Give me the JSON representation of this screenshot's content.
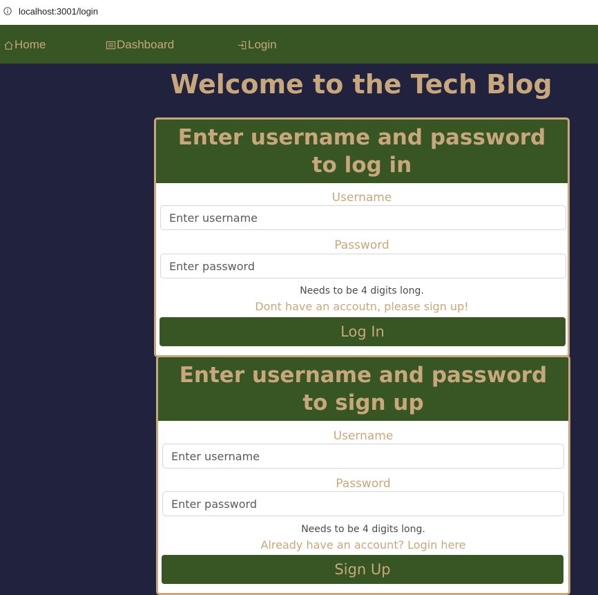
{
  "browser": {
    "url": "localhost:3001/login"
  },
  "nav": {
    "home": "Home",
    "dashboard": "Dashboard",
    "login": "Login"
  },
  "page": {
    "title": "Welcome to the Tech Blog"
  },
  "login_form": {
    "heading": "Enter username and password to log in",
    "username_label": "Username",
    "username_placeholder": "Enter username",
    "password_label": "Password",
    "password_placeholder": "Enter password",
    "hint": "Needs to be 4 digits long.",
    "switch_link": "Dont have an accoutn, please sign up!",
    "submit": "Log In"
  },
  "signup_form": {
    "heading": "Enter username and password to sign up",
    "username_label": "Username",
    "username_placeholder": "Enter username",
    "password_label": "Password",
    "password_placeholder": "Enter password",
    "hint": "Needs to be 4 digits long.",
    "switch_link": "Already have an account? Login here",
    "submit": "Sign Up"
  },
  "colors": {
    "background": "#21223d",
    "primary_green": "#375623",
    "accent_tan": "#c9a77c"
  },
  "icons": {
    "address": "info-icon",
    "home": "home-icon",
    "dashboard": "list-icon",
    "login": "login-icon"
  }
}
